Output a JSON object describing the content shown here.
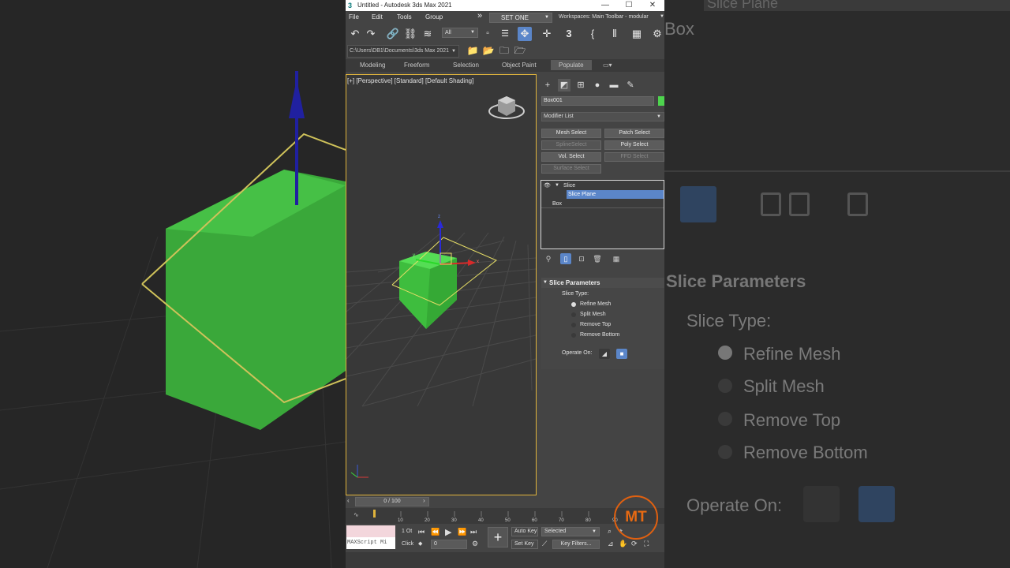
{
  "window": {
    "title": "Untitled - Autodesk 3ds Max 2021",
    "minimize": "—",
    "maximize": "☐",
    "close": "✕"
  },
  "menu": {
    "items": [
      "File",
      "Edit",
      "Tools",
      "Group"
    ],
    "overflow": "»",
    "selection_set": "SET ONE",
    "workspaces": "Workspaces:  Main Toolbar - modular"
  },
  "toolbar": {
    "selection_filter": "All"
  },
  "project_path": "C:\\Users\\DB1\\Documents\\3ds Max 2021",
  "ribbon": {
    "tabs": [
      "Modeling",
      "Freeform",
      "Selection",
      "Object Paint",
      "Populate"
    ],
    "active_tab": "Populate"
  },
  "viewport": {
    "label": "[+] [Perspective] [Standard] [Default Shading]",
    "axis_x": "x",
    "axis_y": "y",
    "axis_z": "z"
  },
  "command_panel": {
    "object_name": "Box001",
    "object_color": "#4ed44e",
    "modifier_list": "Modifier List",
    "modifier_buttons": [
      {
        "label": "Mesh Select",
        "enabled": true
      },
      {
        "label": "Patch Select",
        "enabled": true
      },
      {
        "label": "SplineSelect",
        "enabled": false
      },
      {
        "label": "Poly Select",
        "enabled": true
      },
      {
        "label": "Vol. Select",
        "enabled": true
      },
      {
        "label": "FFD Select",
        "enabled": false
      },
      {
        "label": "Surface Select",
        "enabled": false
      }
    ],
    "stack": {
      "modifier": "Slice",
      "sub_object": "Slice Plane",
      "base": "Box"
    },
    "slice_parameters": {
      "title": "Slice Parameters",
      "slice_type_label": "Slice Type:",
      "options": [
        "Refine Mesh",
        "Split Mesh",
        "Remove Top",
        "Remove Bottom"
      ],
      "selected_option": "Refine Mesh",
      "operate_on_label": "Operate On:"
    }
  },
  "timeline": {
    "frame_display": "0 / 100",
    "ticks": [
      "10",
      "20",
      "30",
      "40",
      "50",
      "60",
      "70",
      "80",
      "90"
    ]
  },
  "status": {
    "maxscript": "MAXScript Mi",
    "line1": "1 Ot",
    "line2": "Click",
    "auto_key": "Auto Key",
    "set_key": "Set Key",
    "key_mode": "Selected",
    "key_filters": "Key Filters...",
    "current_frame": "0"
  },
  "background_copy": {
    "title": "Slice Plane",
    "box": "Box",
    "section": "Slice Parameters",
    "slice_type": "Slice Type:",
    "options": [
      "Refine Mesh",
      "Split Mesh",
      "Remove Top",
      "Remove Bottom"
    ],
    "operate_on": "Operate On:"
  },
  "watermark": "MT"
}
